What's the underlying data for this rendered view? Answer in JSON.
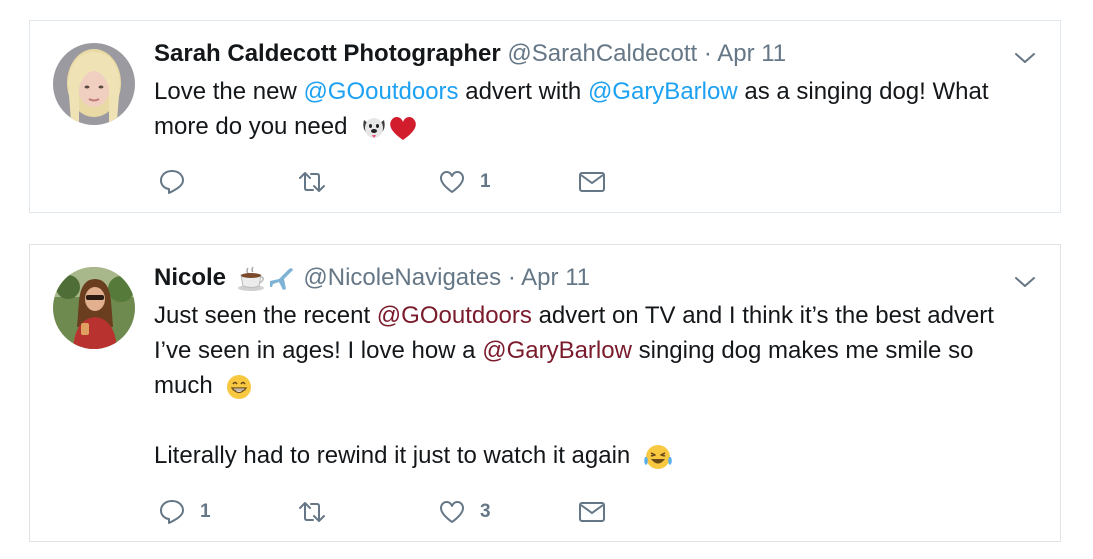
{
  "tweets": [
    {
      "name": "Sarah Caldecott Photographer",
      "name_emoji": "",
      "handle": "@SarahCaldecott",
      "separator": "·",
      "date": "Apr 11",
      "line1": {
        "a": "Love the new ",
        "m1": "@GOoutdoors",
        "b": " advert with ",
        "m2": "@GaryBarlow",
        "c": " as a singing dog! What"
      },
      "line2": "more do you need",
      "line2_emoji": [
        "dog-face-emoji",
        "red-heart-emoji"
      ],
      "actions": {
        "reply_count": "",
        "retweet_count": "",
        "like_count": "1"
      },
      "mention_color": "#1da1f2"
    },
    {
      "name": "Nicole",
      "name_emoji": [
        "hot-beverage-emoji",
        "airplane-emoji"
      ],
      "handle": "@NicoleNavigates",
      "separator": "·",
      "date": "Apr 11",
      "line1": {
        "a": "Just seen the recent ",
        "m1": "@GOoutdoors",
        "b": " advert on TV and I think it’s the best advert"
      },
      "line2": {
        "a": "I’ve seen in ages! I love how a ",
        "m1": "@GaryBarlow",
        "b": " singing dog makes me smile so"
      },
      "line3": "much",
      "line3_emoji": "grinning-face-emoji",
      "line5": "Literally had to rewind it just to watch it again",
      "line5_emoji": "tears-of-joy-emoji",
      "actions": {
        "reply_count": "1",
        "retweet_count": "",
        "like_count": "3"
      },
      "mention_color": "#7a1b2c"
    }
  ]
}
